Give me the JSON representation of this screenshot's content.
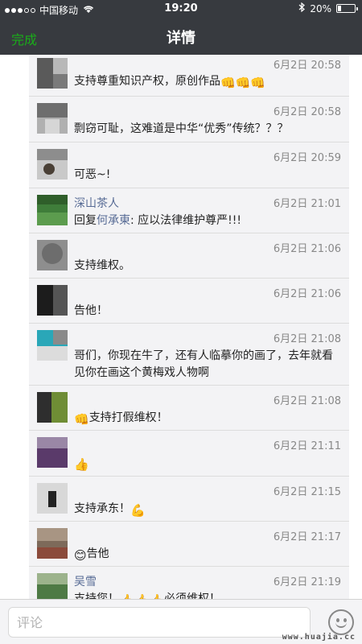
{
  "status_bar": {
    "carrier": "中国移动",
    "time": "19:20",
    "battery_text": "20%",
    "battery_level": 0.2,
    "wifi_icon": "wifi-icon",
    "bluetooth_icon": "bluetooth-icon"
  },
  "nav": {
    "done_label": "完成",
    "title": "详情"
  },
  "comments": [
    {
      "name": "",
      "time": "6月2日 20:58",
      "text": "支持尊重知识产权，原创作品",
      "emoji": "👊👊👊"
    },
    {
      "name": "",
      "time": "6月2日 20:58",
      "text": "剽窃可耻，这难道是中华“优秀”传统？？？"
    },
    {
      "name": "",
      "time": "6月2日 20:59",
      "text": "可恶~!"
    },
    {
      "name": "深山茶人",
      "time": "6月2日 21:01",
      "reply_prefix": "回复",
      "reply_to": "何承東",
      "text": ": 应以法律维护尊严!!!"
    },
    {
      "name": "",
      "time": "6月2日 21:06",
      "text": "支持维权。"
    },
    {
      "name": "",
      "time": "6月2日 21:06",
      "text": "告他！"
    },
    {
      "name": "",
      "time": "6月2日 21:08",
      "text": "哥们，你现在牛了，还有人临摹你的画了，去年就看见你在画这个黄梅戏人物啊"
    },
    {
      "name": "",
      "time": "6月2日 21:08",
      "emoji_before": "👊",
      "text": "支持打假维权！"
    },
    {
      "name": "",
      "time": "6月2日 21:11",
      "text": "",
      "emoji": "👍"
    },
    {
      "name": "",
      "time": "6月2日 21:15",
      "text": "支持承东！",
      "emoji": "💪"
    },
    {
      "name": "",
      "time": "6月2日 21:17",
      "emoji_before": "😊",
      "text": "告他"
    },
    {
      "name": "吴雪",
      "time": "6月2日 21:19",
      "text": "支持您！",
      "emoji": "👍👍👍",
      "text_after": "必须维权！"
    }
  ],
  "bottom_bar": {
    "comment_placeholder": "评论",
    "emoji_icon": "smiley-icon"
  },
  "watermark": "www.huajia.cc",
  "colors": {
    "header_bg": "#373a3f",
    "accent_green": "#1aad19",
    "link_blue": "#576b95",
    "panel_bg": "#f3f3f5"
  }
}
